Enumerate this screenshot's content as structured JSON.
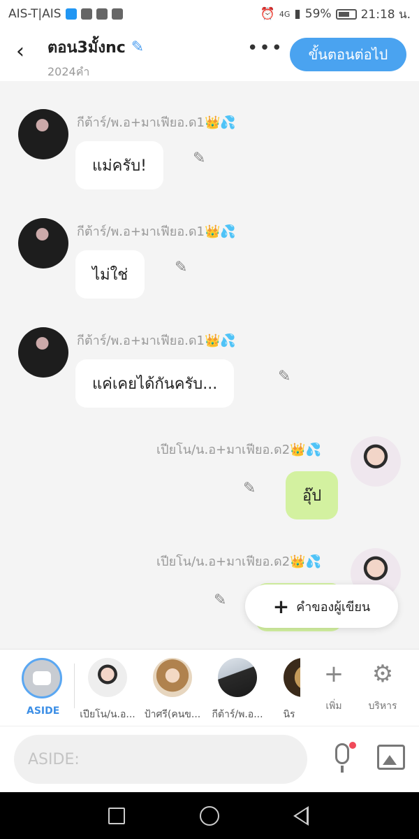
{
  "statusbar": {
    "carrier": "AIS-T|AIS",
    "network": "4G",
    "battery": "59%",
    "time": "21:18 น."
  },
  "header": {
    "back_icon": "back-arrow-icon",
    "title": "ตอน3มั้งnc",
    "edit_icon": "pencil-icon",
    "word_count": "2024คำ",
    "more_icon": "more-dots-icon",
    "next_label": "ขั้นตอนต่อไป",
    "accent_color": "#4aa3f0"
  },
  "messages": [
    {
      "side": "left",
      "name": "กีต้าร์/พ.อ+มาเฟียอ.ด1👑💦",
      "text": "แม่ครับ!"
    },
    {
      "side": "left",
      "name": "กีต้าร์/พ.อ+มาเฟียอ.ด1👑💦",
      "text": "ไม่ใช่"
    },
    {
      "side": "left",
      "name": "กีต้าร์/พ.อ+มาเฟียอ.ด1👑💦",
      "text": "แค่เคยได้กันครับ..."
    },
    {
      "side": "right",
      "name": "เปียโน/น.อ+มาเฟียอ.ด2👑💦",
      "text": "อุ๊ป"
    },
    {
      "side": "right",
      "name": "เปียโน/น.อ+มาเฟียอ.ด2👑💦",
      "text": ""
    }
  ],
  "fab": {
    "label": "คำของผู้เขียน",
    "icon": "plus-icon"
  },
  "charbar": {
    "aside_label": "ASIDE",
    "characters": [
      {
        "label": "เปียโน/น.อ..."
      },
      {
        "label": "ป้าศรี(คนข..."
      },
      {
        "label": "กีต้าร์/พ.อ..."
      },
      {
        "label": "นิร"
      }
    ],
    "add_label": "เพิ่ม",
    "manage_label": "บริหาร"
  },
  "input": {
    "placeholder": "ASIDE:",
    "mic_icon": "mic-icon",
    "image_icon": "image-icon"
  },
  "colors": {
    "left_bubble": "#ffffff",
    "right_bubble": "#d3f1a0",
    "background": "#f4f4f4"
  }
}
